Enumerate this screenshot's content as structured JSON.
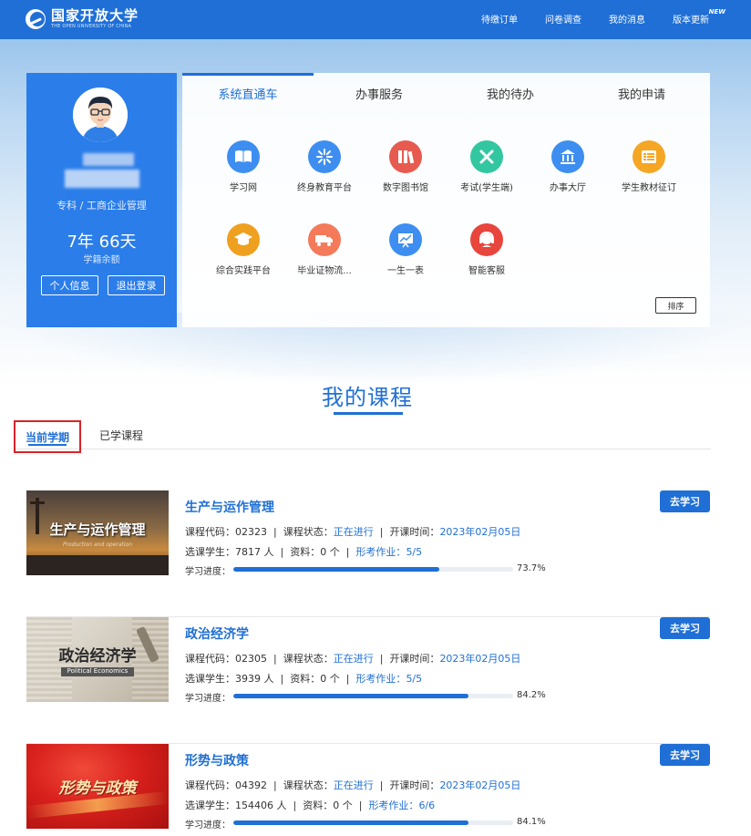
{
  "header": {
    "logo_cn": "国家开放大学",
    "logo_en": "THE OPEN UNIVERSITY OF CHINA",
    "nav": [
      {
        "label": "待缴订单"
      },
      {
        "label": "问卷调查"
      },
      {
        "label": "我的消息"
      },
      {
        "label": "版本更新",
        "badge": "NEW"
      }
    ]
  },
  "profile": {
    "major": "专科 / 工商企业管理",
    "years": "7年 66天",
    "years_label": "学籍余额",
    "info_button": "个人信息",
    "logout_button": "退出登录"
  },
  "services": {
    "tabs": [
      "系统直通车",
      "办事服务",
      "我的待办",
      "我的申请"
    ],
    "items": [
      {
        "label": "学习网",
        "icon": "book-icon",
        "color": "#3d8ef0"
      },
      {
        "label": "终身教育平台",
        "icon": "snowflake-icon",
        "color": "#3d8ef0"
      },
      {
        "label": "数字图书馆",
        "icon": "bookshelf-icon",
        "color": "#e75a4f"
      },
      {
        "label": "考试(学生端)",
        "icon": "pencil-ruler-icon",
        "color": "#32c7a0"
      },
      {
        "label": "办事大厅",
        "icon": "building-icon",
        "color": "#3d8ef0"
      },
      {
        "label": "学生教材征订",
        "icon": "list-icon",
        "color": "#f5a623"
      },
      {
        "label": "综合实践平台",
        "icon": "graduation-cap-icon",
        "color": "#f0a020"
      },
      {
        "label": "毕业证物流...",
        "icon": "truck-icon",
        "color": "#f47a5a"
      },
      {
        "label": "一生一表",
        "icon": "chart-board-icon",
        "color": "#3d8ef0"
      },
      {
        "label": "智能客服",
        "icon": "headset-icon",
        "color": "#e8453c"
      }
    ],
    "sort_button": "排序"
  },
  "courses": {
    "title": "我的课程",
    "tabs": [
      "当前学期",
      "已学课程"
    ],
    "labels": {
      "code": "课程代码：",
      "status": "课程状态：",
      "start": "开课时间：",
      "students": "选课学生：",
      "materials": "资料：",
      "homework": "形考作业：",
      "progress": "学习进度：",
      "go": "去学习"
    },
    "list": [
      {
        "name": "生产与运作管理",
        "code": "02323",
        "status": "正在进行",
        "start": "2023年02月05日",
        "students": "7817 人",
        "materials": "0 个",
        "homework": "5/5",
        "progress": 73.7,
        "progress_text": "73.7%",
        "thumb_title": "生产与运作管理",
        "thumb_sub": "Production and operation"
      },
      {
        "name": "政治经济学",
        "code": "02305",
        "status": "正在进行",
        "start": "2023年02月05日",
        "students": "3939 人",
        "materials": "0 个",
        "homework": "5/5",
        "progress": 84.2,
        "progress_text": "84.2%",
        "thumb_title": "政治经济学",
        "thumb_sub": "Political Economics"
      },
      {
        "name": "形势与政策",
        "code": "04392",
        "status": "正在进行",
        "start": "2023年02月05日",
        "students": "154406 人",
        "materials": "0 个",
        "homework": "6/6",
        "progress": 84.1,
        "progress_text": "84.1%",
        "thumb_title": "形势与政策",
        "thumb_sub": ""
      }
    ]
  }
}
